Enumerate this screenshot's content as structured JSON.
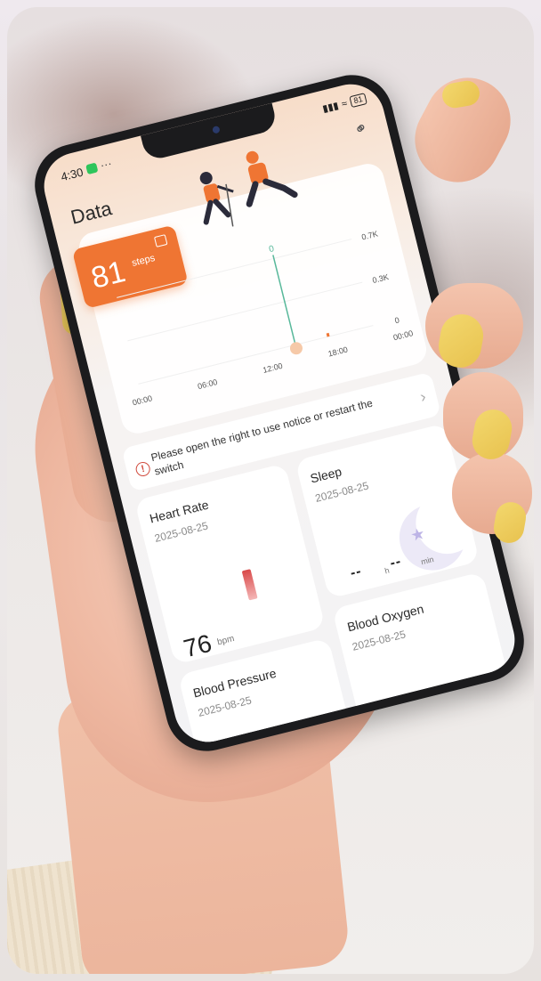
{
  "status_bar": {
    "time": "4:30",
    "dots": "···",
    "battery": "81"
  },
  "page": {
    "title": "Data"
  },
  "steps": {
    "value": "81",
    "unit": "steps"
  },
  "chart_data": {
    "type": "bar",
    "x_tick_labels": [
      "00:00",
      "06:00",
      "12:00",
      "18:00",
      "00:00"
    ],
    "y_tick_labels": [
      "0.7K",
      "0.3K",
      "0"
    ],
    "ylim": [
      0,
      700
    ],
    "series": [
      {
        "values": [
          {
            "time": "17:30",
            "value": 20
          }
        ]
      }
    ],
    "cursor_label": "0"
  },
  "notice": {
    "text": "Please open the right to use notice or restart the switch"
  },
  "heart_rate": {
    "title": "Heart Rate",
    "date": "2025-08-25",
    "value": "76",
    "unit": "bpm"
  },
  "sleep": {
    "title": "Sleep",
    "date": "2025-08-25",
    "hours": "--",
    "h_unit": "h",
    "minutes": "--",
    "min_unit": "min"
  },
  "blood_pressure": {
    "title": "Blood Pressure",
    "date": "2025-08-25"
  },
  "blood_oxygen": {
    "title": "Blood Oxygen",
    "date": "2025-08-25"
  },
  "colors": {
    "accent": "#ef7533",
    "chart_cursor": "#58b89a",
    "alert": "#d0483b"
  }
}
